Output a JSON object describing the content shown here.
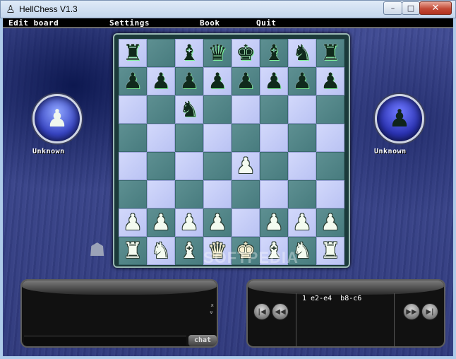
{
  "window": {
    "title": "HellChess V1.3",
    "app_icon": "pawn-icon",
    "controls": {
      "minimize": "–",
      "maximize": "□",
      "close": "✕"
    }
  },
  "menu": {
    "items": [
      "Edit board",
      "Settings",
      "Book",
      "Quit"
    ]
  },
  "players": {
    "left": {
      "name": "Unknown",
      "piece": "♟",
      "color": "white"
    },
    "right": {
      "name": "Unknown",
      "piece": "♟",
      "color": "black"
    }
  },
  "board": {
    "rows": [
      [
        "bR",
        "",
        "bB",
        "bQ",
        "bK",
        "bB",
        "bN",
        "bR"
      ],
      [
        "bP",
        "bP",
        "bP",
        "bP",
        "bP",
        "bP",
        "bP",
        "bP"
      ],
      [
        "",
        "",
        "bN",
        "",
        "",
        "",
        "",
        ""
      ],
      [
        "",
        "",
        "",
        "",
        "",
        "",
        "",
        ""
      ],
      [
        "",
        "",
        "",
        "",
        "wP",
        "",
        "",
        ""
      ],
      [
        "",
        "",
        "",
        "",
        "",
        "",
        "",
        ""
      ],
      [
        "wP",
        "wP",
        "wP",
        "wP",
        "",
        "wP",
        "wP",
        "wP"
      ],
      [
        "wR",
        "wN",
        "wB",
        "wQ",
        "wK",
        "wB",
        "wN",
        "wR"
      ]
    ],
    "glyphs": {
      "bR": "♜",
      "bN": "♞",
      "bB": "♝",
      "bQ": "♛",
      "bK": "♚",
      "bP": "♟",
      "wR": "♜",
      "wN": "♞",
      "wB": "♝",
      "wQ": "♛",
      "wK": "♚",
      "wP": "♟"
    }
  },
  "watermark": "SOFTPEDIA",
  "chat": {
    "button_label": "chat",
    "scroll_glyph": "«"
  },
  "moves": {
    "text": "1 e2-e4  b8-c6",
    "nav": {
      "first": "|◀",
      "prev": "◀◀",
      "next": "▶▶",
      "last": "▶|"
    }
  },
  "colors": {
    "light_square": "#c6cdf7",
    "dark_square": "#558789",
    "background": "#3a4588"
  }
}
